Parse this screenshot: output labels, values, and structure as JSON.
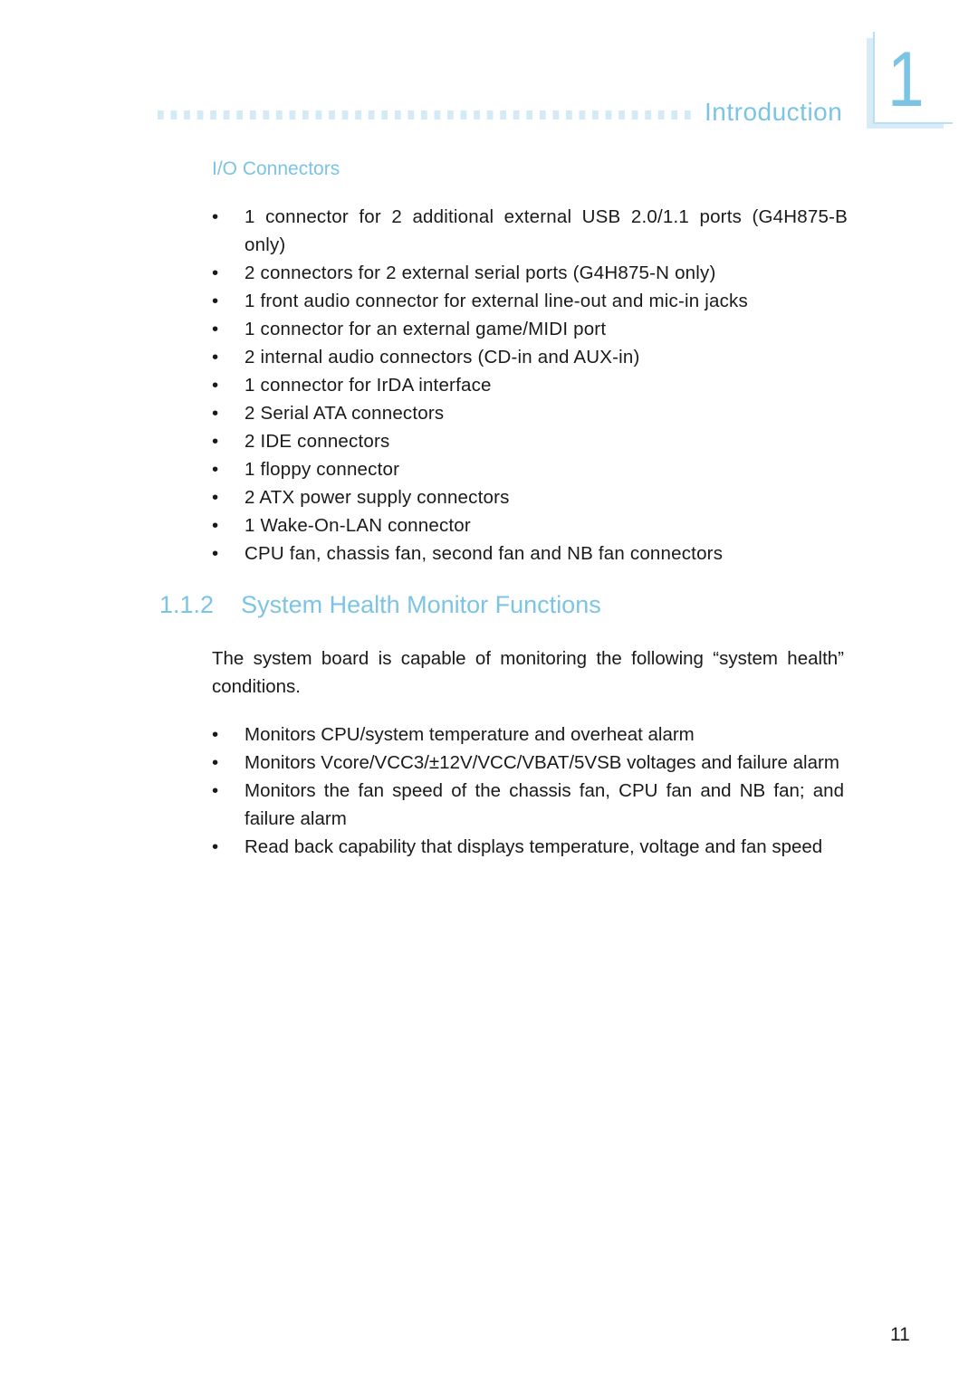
{
  "header": {
    "chapter_title": "Introduction",
    "chapter_number": "1"
  },
  "io_section": {
    "title": "I/O Connectors",
    "bullet_symbol": "•",
    "items": [
      "1 connector for 2 additional external USB 2.0/1.1 ports (G4H875-B only)",
      "2 connectors for 2 external serial ports (G4H875-N only)",
      "1 front audio connector for external line-out and mic-in jacks",
      "1 connector for an external game/MIDI port",
      "2 internal audio connectors (CD-in and AUX-in)",
      "1 connector for IrDA interface",
      "2 Serial ATA connectors",
      "2 IDE connectors",
      "1 floppy connector",
      "2 ATX power supply connectors",
      "1 Wake-On-LAN connector",
      "CPU fan, chassis fan, second fan and NB fan connectors"
    ]
  },
  "health_section": {
    "number": "1.1.2",
    "title": "System Health Monitor Functions",
    "intro": "The system board is capable of monitoring the following “system health” conditions.",
    "bullet_symbol": "•",
    "items": [
      "Monitors CPU/system temperature and overheat alarm",
      "Monitors Vcore/VCC3/±12V/VCC/VBAT/5VSB voltages and failure alarm",
      "Monitors the fan speed of the chassis fan, CPU fan and NB fan; and failure alarm",
      "Read back capability that displays temperature, voltage and fan speed"
    ]
  },
  "footer": {
    "page_number": "11"
  },
  "colors": {
    "accent": "#7cc4e3",
    "accent_light": "#d4ebf6",
    "text": "#1a1a1a"
  }
}
